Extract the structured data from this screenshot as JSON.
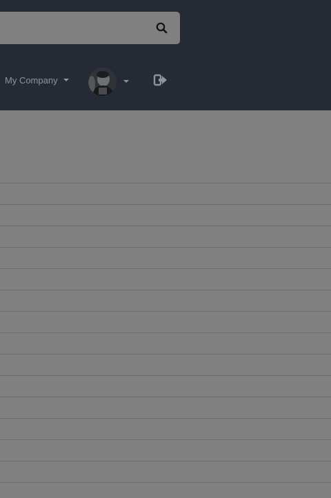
{
  "header": {
    "search": {
      "placeholder": "",
      "value": "",
      "icon": "search-icon"
    },
    "company_menu": {
      "label": "My Company",
      "icon": "caret-down-icon"
    },
    "user_menu": {
      "avatar": "avatar",
      "icon": "caret-down-icon"
    },
    "logout": {
      "icon": "sign-out-icon"
    }
  },
  "table": {
    "rows": [
      "",
      "",
      "",
      "",
      "",
      "",
      "",
      "",
      "",
      "",
      "",
      "",
      "",
      "",
      ""
    ]
  },
  "colors": {
    "header_bg": "#242b37",
    "overlay": "#808080",
    "muted_text": "#8e949c"
  }
}
